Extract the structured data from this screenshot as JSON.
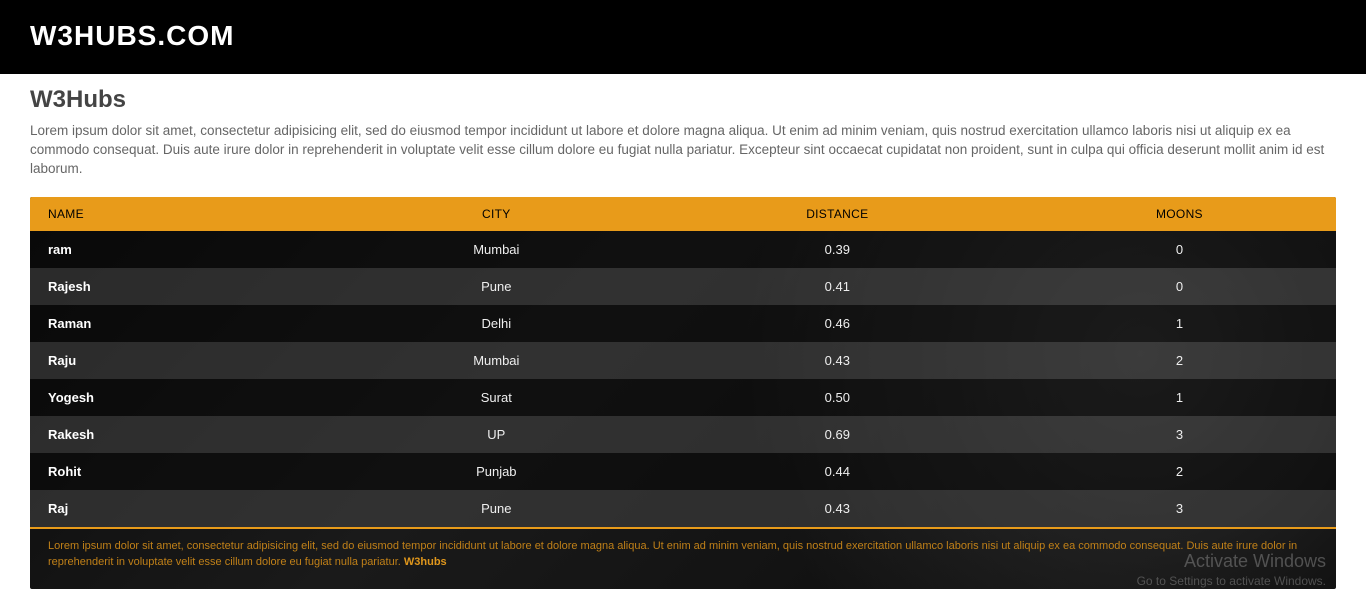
{
  "header": {
    "logo": "W3HUBS.COM"
  },
  "page": {
    "title": "W3Hubs",
    "intro": "Lorem ipsum dolor sit amet, consectetur adipisicing elit, sed do eiusmod tempor incididunt ut labore et dolore magna aliqua. Ut enim ad minim veniam, quis nostrud exercitation ullamco laboris nisi ut aliquip ex ea commodo consequat. Duis aute irure dolor in reprehenderit in voluptate velit esse cillum dolore eu fugiat nulla pariatur. Excepteur sint occaecat cupidatat non proident, sunt in culpa qui officia deserunt mollit anim id est laborum."
  },
  "table": {
    "headers": [
      "NAME",
      "CITY",
      "DISTANCE",
      "MOONS"
    ],
    "rows": [
      {
        "name": "ram",
        "city": "Mumbai",
        "distance": "0.39",
        "moons": "0"
      },
      {
        "name": "Rajesh",
        "city": "Pune",
        "distance": "0.41",
        "moons": "0"
      },
      {
        "name": "Raman",
        "city": "Delhi",
        "distance": "0.46",
        "moons": "1"
      },
      {
        "name": "Raju",
        "city": "Mumbai",
        "distance": "0.43",
        "moons": "2"
      },
      {
        "name": "Yogesh",
        "city": "Surat",
        "distance": "0.50",
        "moons": "1"
      },
      {
        "name": "Rakesh",
        "city": "UP",
        "distance": "0.69",
        "moons": "3"
      },
      {
        "name": "Rohit",
        "city": "Punjab",
        "distance": "0.44",
        "moons": "2"
      },
      {
        "name": "Raj",
        "city": "Pune",
        "distance": "0.43",
        "moons": "3"
      }
    ]
  },
  "footer": {
    "text": "Lorem ipsum dolor sit amet, consectetur adipisicing elit, sed do eiusmod tempor incididunt ut labore et dolore magna aliqua. Ut enim ad minim veniam, quis nostrud exercitation ullamco laboris nisi ut aliquip ex ea commodo consequat. Duis aute irure dolor in reprehenderit in voluptate velit esse cillum dolore eu fugiat nulla pariatur. ",
    "brand": "W3hubs"
  },
  "watermark": {
    "line1": "Activate Windows",
    "line2": "Go to Settings to activate Windows."
  }
}
